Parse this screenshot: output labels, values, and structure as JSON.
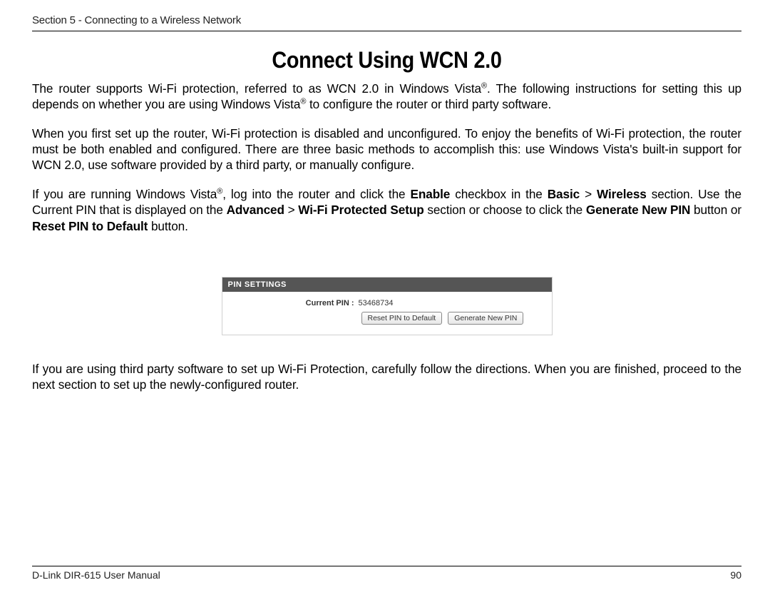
{
  "header": {
    "section": "Section 5 - Connecting to a Wireless Network"
  },
  "title": "Connect Using WCN 2.0",
  "para1a": "The router supports Wi-Fi protection, referred to as WCN 2.0 in Windows Vista",
  "para1b": ". The following instructions for setting this up depends on whether you are using Windows Vista",
  "para1c": " to configure the router or third party software.",
  "reg": "®",
  "para2": "When you first set up the router, Wi-Fi protection is disabled and unconfigured. To enjoy the benefits of Wi-Fi protection, the router must be both enabled and configured. There are three basic methods to accomplish this: use Windows Vista's built-in support for WCN 2.0, use software provided by a third party, or manually configure.",
  "para3a": "If you are running Windows Vista",
  "para3b": ", log into the router and click the ",
  "para3_enable": "Enable",
  "para3c": " checkbox in the ",
  "para3_basic": "Basic",
  "para3_gt": " > ",
  "para3_wireless": "Wireless",
  "para3d": " section. Use the Current PIN that is displayed on the ",
  "para3_advanced": "Advanced",
  "para3_wps": "Wi-Fi Protected Setup",
  "para3e": " section or choose to click the ",
  "para3_generate": "Generate New PIN",
  "para3f": " button or ",
  "para3_reset": "Reset PIN to Default",
  "para3g": " button.",
  "panel": {
    "heading": "PIN SETTINGS",
    "label": "Current PIN :",
    "value": "53468734",
    "reset_btn": "Reset PIN to Default",
    "generate_btn": "Generate New PIN"
  },
  "para4": "If you are using third party software to set up Wi-Fi Protection, carefully follow the directions. When you are finished, proceed to the next section to set up the newly-configured router.",
  "footer": {
    "left": "D-Link DIR-615 User Manual",
    "right": "90"
  }
}
